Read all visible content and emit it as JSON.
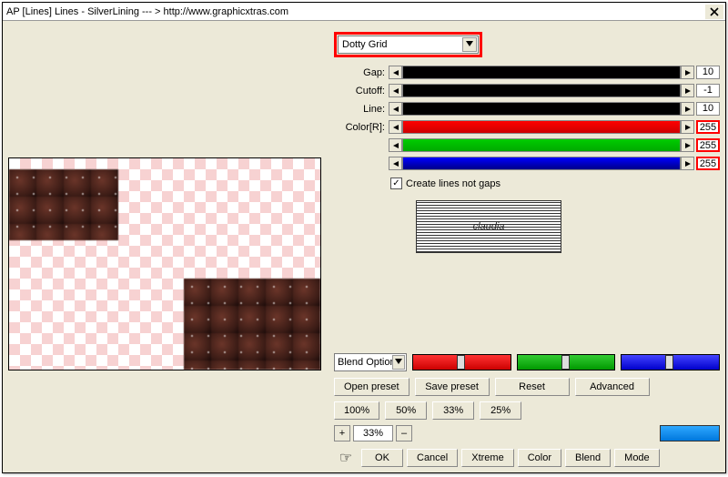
{
  "window": {
    "title": "AP [Lines]  Lines - SilverLining   --- >  http://www.graphicxtras.com"
  },
  "preset": {
    "selected": "Dotty Grid"
  },
  "sliders": {
    "gap": {
      "label": "Gap:",
      "value": "10"
    },
    "cutoff": {
      "label": "Cutoff:",
      "value": "-1"
    },
    "line": {
      "label": "Line:",
      "value": "10"
    },
    "colorR": {
      "label": "Color[R]:",
      "value": "255"
    },
    "colorG": {
      "label": "",
      "value": "255"
    },
    "colorB": {
      "label": "",
      "value": "255"
    }
  },
  "checkbox": {
    "create_lines": {
      "label": "Create lines not gaps",
      "checked": true
    }
  },
  "logo": {
    "text": "claudia"
  },
  "blend": {
    "label": "Blend Options"
  },
  "buttons": {
    "open_preset": "Open preset",
    "save_preset": "Save preset",
    "reset": "Reset",
    "advanced": "Advanced",
    "p100": "100%",
    "p50": "50%",
    "p33": "33%",
    "p25": "25%",
    "ok": "OK",
    "cancel": "Cancel",
    "xtreme": "Xtreme",
    "color": "Color",
    "blend": "Blend",
    "mode": "Mode"
  },
  "zoom": {
    "plus": "+",
    "minus": "–",
    "value": "33%"
  }
}
